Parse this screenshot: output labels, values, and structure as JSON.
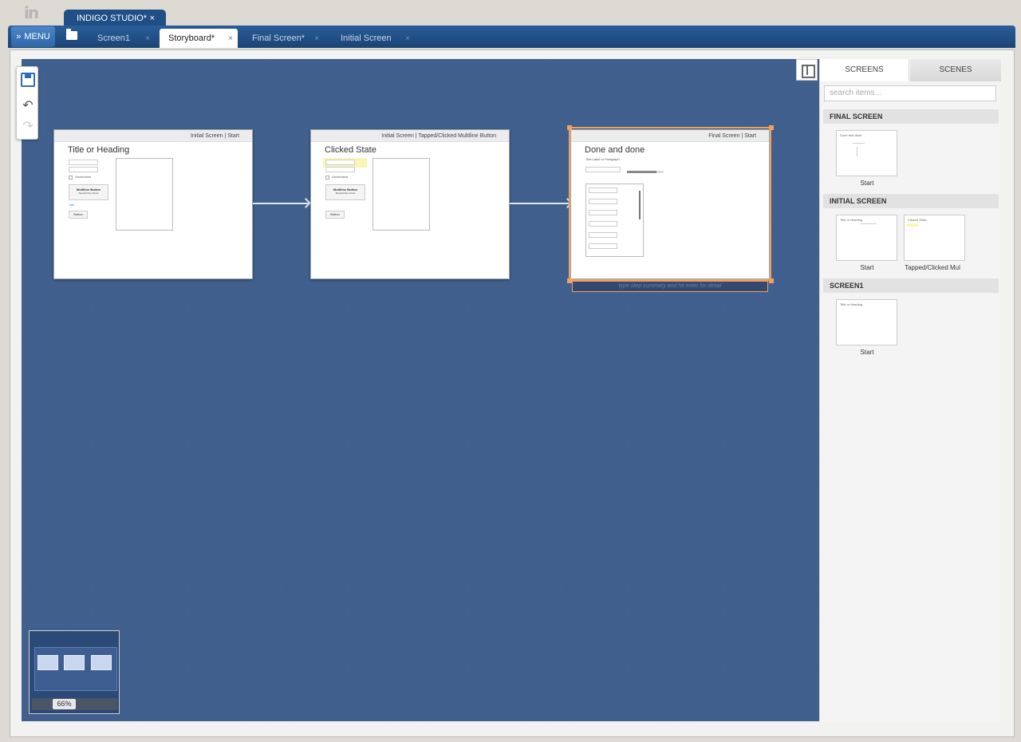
{
  "app": {
    "tab_title": "INDIGO STUDIO*",
    "logo": "in"
  },
  "menu": {
    "label": "MENU",
    "glyph": "»"
  },
  "doc_tabs": [
    {
      "label": "Screen1"
    },
    {
      "label": "Storyboard*",
      "active": true
    },
    {
      "label": "Final Screen*"
    },
    {
      "label": "Initial Screen"
    }
  ],
  "close_glyph": "×",
  "toolbox": {
    "undo_glyph": "↶",
    "redo_glyph": "↷"
  },
  "storyboard": {
    "steps": [
      {
        "header_screen": "Initial Screen",
        "header_state": "Start",
        "title": "Title or Heading",
        "checkbox_label": "Unchecked",
        "button_title": "Multiline Button",
        "button_sub": "Second line of text",
        "link_text": "link",
        "plain_button": "Button"
      },
      {
        "header_screen": "Initial Screen",
        "header_state": "Tapped/Clicked Multiline Button",
        "title": "Clicked State",
        "checkbox_label": "Unchecked",
        "button_title": "Multiline Button",
        "button_sub": "Second line of text",
        "plain_button": "Button"
      },
      {
        "header_screen": "Final Screen",
        "header_state": "Start",
        "title": "Done and done",
        "subtitle": "Text Label or Paragraph",
        "progress": 0.8
      }
    ],
    "step_placeholder": "type step summary and hit enter for detail"
  },
  "zoom": "66%",
  "side_panel": {
    "tabs": [
      "SCREENS",
      "SCENES"
    ],
    "search_placeholder": "search items...",
    "sections": [
      {
        "title": "FINAL SCREEN",
        "items": [
          "Start"
        ]
      },
      {
        "title": "INITIAL SCREEN",
        "items": [
          "Start",
          "Tapped/Clicked Mul"
        ]
      },
      {
        "title": "SCREEN1",
        "items": [
          "Start"
        ]
      }
    ]
  },
  "colors": {
    "canvas": "#3f5e8c",
    "tab_bar": "#1f4f86",
    "selection": "#f0a060",
    "accent": "#2f6db5"
  }
}
